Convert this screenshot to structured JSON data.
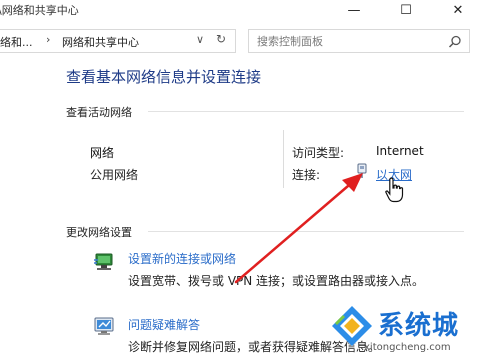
{
  "window": {
    "title": "\\网络和共享中心",
    "minimize_glyph": "—",
    "maximize_glyph": "☐",
    "close_glyph": "✕"
  },
  "address": {
    "previous": "络和...",
    "separator": "›",
    "current": "网络和共享中心",
    "dropdown_glyph": "∨",
    "refresh_glyph": "↻",
    "search_placeholder": "搜索控制面板"
  },
  "content": {
    "title": "查看基本网络信息并设置连接",
    "active_networks_heading": "查看活动网络",
    "network": {
      "name": "网络",
      "category": "公用网络",
      "access_type_label": "访问类型:",
      "access_type_value": "Internet",
      "connections_label": "连接:",
      "connection_name": "以太网"
    },
    "change_settings_heading": "更改网络设置",
    "tasks": [
      {
        "icon": "new-connection-icon",
        "link": "设置新的连接或网络",
        "description": "设置宽带、拨号或 VPN 连接；或设置路由器或接入点。"
      },
      {
        "icon": "troubleshoot-icon",
        "link": "问题疑难解答",
        "description": "诊断并修复网络问题，或者获得疑难解答信息。"
      }
    ]
  },
  "watermark": {
    "brand": "系统城",
    "site": "xitongcheng.com"
  },
  "colors": {
    "link": "#2a6cc9",
    "title": "#1e3b87",
    "arrow": "#e02020"
  }
}
